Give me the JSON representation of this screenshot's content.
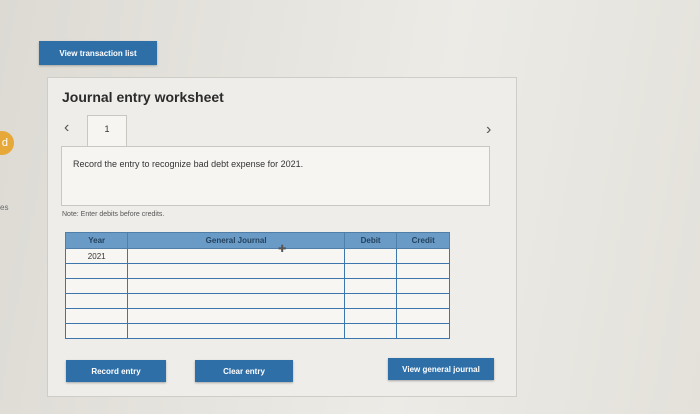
{
  "left_edge": {
    "badge_text": "d",
    "label": "es"
  },
  "view_transaction_list_label": "View transaction list",
  "worksheet": {
    "title": "Journal entry worksheet",
    "active_tab": "1",
    "instruction": "Record the entry to recognize bad debt expense for 2021.",
    "note": "Note: Enter debits before credits."
  },
  "table": {
    "headers": {
      "year": "Year",
      "general_journal": "General Journal",
      "debit": "Debit",
      "credit": "Credit"
    },
    "rows": [
      {
        "year": "2021",
        "account": "",
        "debit": "",
        "credit": ""
      },
      {
        "year": "",
        "account": "",
        "debit": "",
        "credit": ""
      },
      {
        "year": "",
        "account": "",
        "debit": "",
        "credit": ""
      },
      {
        "year": "",
        "account": "",
        "debit": "",
        "credit": ""
      },
      {
        "year": "",
        "account": "",
        "debit": "",
        "credit": ""
      },
      {
        "year": "",
        "account": "",
        "debit": "",
        "credit": ""
      }
    ]
  },
  "buttons": {
    "record_entry": "Record entry",
    "clear_entry": "Clear entry",
    "view_general_journal": "View general journal"
  },
  "icons": {
    "prev": "chevron-left-icon",
    "next": "chevron-right-icon",
    "cursor": "move-cursor-icon"
  }
}
